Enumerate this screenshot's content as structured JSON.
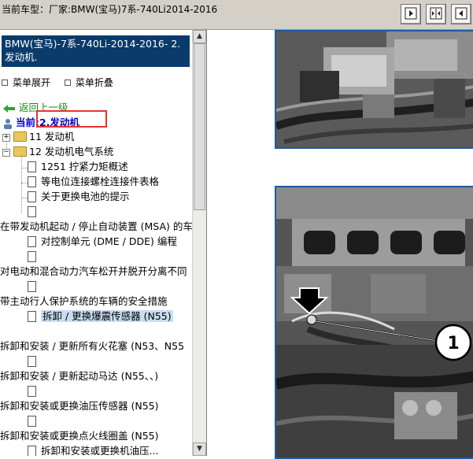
{
  "window": {
    "title": "当前车型：厂家:BMW(宝马)7系-740Li2014-2016"
  },
  "toolbar": {
    "buttons": [
      "expand-right-icon",
      "split-view-icon",
      "expand-left-icon"
    ]
  },
  "sidebar": {
    "selected_header": "BMW(宝马)-7系-740Li-2014-2016- 2.发动机.",
    "menu_expand": "菜单展开",
    "menu_collapse": "菜单折叠",
    "back_link": "返回上一级",
    "current_label": "当前:",
    "current_value": "2.发动机",
    "tree": [
      {
        "label": "11 发动机"
      },
      {
        "label": "12 发动机电气系统"
      },
      {
        "label": "1251 拧紧力矩概述"
      },
      {
        "label": "等电位连接螺栓连接件表格"
      },
      {
        "label": "关于更换电池的提示"
      },
      {
        "label": ""
      },
      {
        "label": "在带发动机起动 / 停止自动装置 (MSA) 的车"
      },
      {
        "label": "对控制单元 (DME / DDE) 编程"
      },
      {
        "label": ""
      },
      {
        "label": "对电动和混合动力汽车松开并脱开分离不同"
      },
      {
        "label": ""
      },
      {
        "label": "带主动行人保护系统的车辆的安全措施"
      },
      {
        "label": "拆卸 / 更换爆震传感器 (N55)"
      },
      {
        "label": "拆卸和安装 / 更新所有火花塞 (N53、N55"
      },
      {
        "label": ""
      },
      {
        "label": "拆卸和安装 / 更新起动马达 (N55、、)"
      },
      {
        "label": ""
      },
      {
        "label": "拆卸和安装或更换油压传感器 (N55)"
      },
      {
        "label": ""
      },
      {
        "label": "拆卸和安装或更换点火线圈盖 (N55)"
      },
      {
        "label": "拆卸和安装或更换机油压..."
      }
    ]
  },
  "content": {
    "callout_number": "1"
  }
}
